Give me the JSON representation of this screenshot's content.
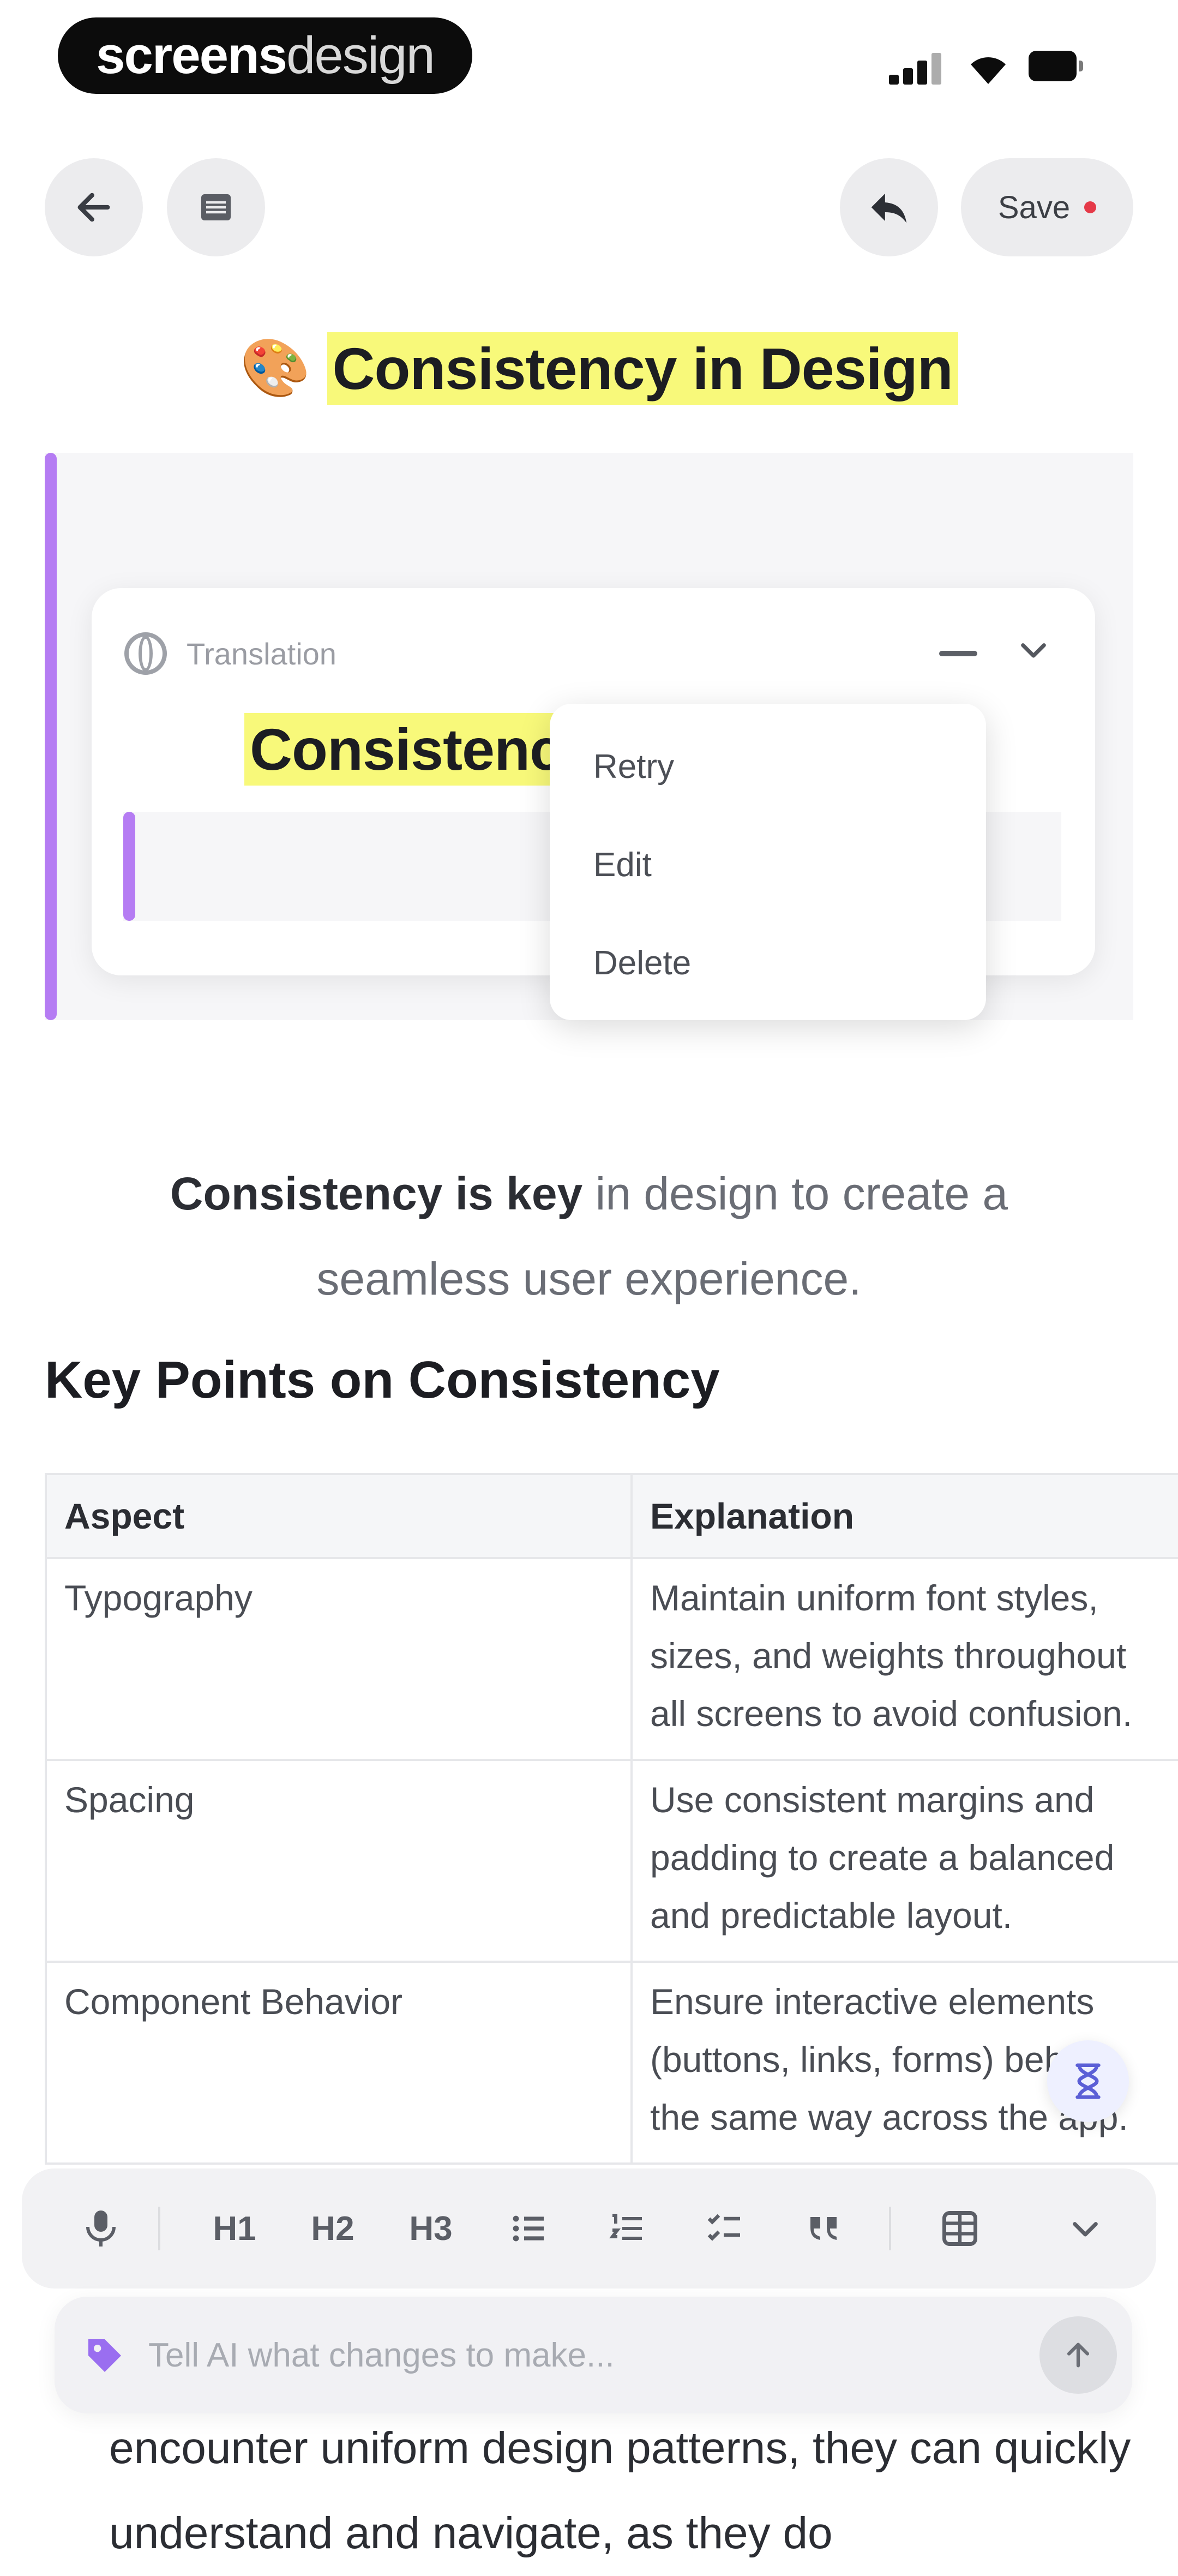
{
  "brand": {
    "part1": "screens",
    "part2": "design"
  },
  "toolbar": {
    "save_label": "Save"
  },
  "document": {
    "title_emoji": "🎨",
    "title": "Consistency in Design"
  },
  "translation_card": {
    "label": "Translation",
    "title_partial": "Consistenc"
  },
  "context_menu": {
    "items": [
      "Retry",
      "Edit",
      "Delete"
    ]
  },
  "lead": {
    "bold": "Consistency is key",
    "rest": " in design to create a seamless user experience."
  },
  "section_heading": "Key Points on Consistency",
  "table": {
    "headers": [
      "Aspect",
      "Explanation"
    ],
    "rows": [
      [
        "Typography",
        "Maintain uniform font styles, sizes, and weights throughout all screens to avoid confusion."
      ],
      [
        "Spacing",
        "Use consistent margins and padding to create a balanced and predictable layout."
      ],
      [
        "Component Behavior",
        "Ensure interactive elements (buttons, links, forms) behave the same way across the app."
      ]
    ]
  },
  "format_bar": {
    "h1": "H1",
    "h2": "H2",
    "h3": "H3"
  },
  "ai_input": {
    "placeholder": "Tell AI what changes to make..."
  },
  "bottom_text": "encounter uniform design patterns, they can quickly understand and navigate, as they do",
  "colors": {
    "accent_purple": "#b57cf3",
    "highlight_yellow": "#f8f97a",
    "save_dot": "#e53948"
  }
}
